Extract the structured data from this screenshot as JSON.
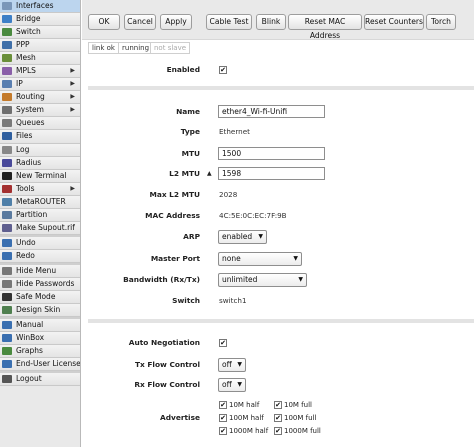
{
  "sidebar": {
    "items": [
      {
        "label": "Interfaces",
        "icon": "interfaces-icon",
        "color": "#7a96b8",
        "submenu": false
      },
      {
        "label": "Bridge",
        "icon": "bridge-icon",
        "color": "#3d7fc6",
        "submenu": false
      },
      {
        "label": "Switch",
        "icon": "switch-icon",
        "color": "#4a8a3f",
        "submenu": false
      },
      {
        "label": "PPP",
        "icon": "ppp-icon",
        "color": "#3f6fa8",
        "submenu": false
      },
      {
        "label": "Mesh",
        "icon": "mesh-icon",
        "color": "#6a8f3a",
        "submenu": false
      },
      {
        "label": "MPLS",
        "icon": "mpls-icon",
        "color": "#8a5fa8",
        "submenu": true
      },
      {
        "label": "IP",
        "icon": "ip-icon",
        "color": "#5a7fb0",
        "submenu": true
      },
      {
        "label": "Routing",
        "icon": "routing-icon",
        "color": "#c47a2a",
        "submenu": true
      },
      {
        "label": "System",
        "icon": "system-icon",
        "color": "#6f6f6f",
        "submenu": true
      },
      {
        "label": "Queues",
        "icon": "queues-icon",
        "color": "#7a7a7a",
        "submenu": false
      },
      {
        "label": "Files",
        "icon": "files-icon",
        "color": "#2f5f9f",
        "submenu": false
      },
      {
        "label": "Log",
        "icon": "log-icon",
        "color": "#888888",
        "submenu": false
      },
      {
        "label": "Radius",
        "icon": "radius-icon",
        "color": "#4a4a9a",
        "submenu": false
      },
      {
        "label": "New Terminal",
        "icon": "terminal-icon",
        "color": "#222222",
        "submenu": false
      },
      {
        "label": "Tools",
        "icon": "tools-icon",
        "color": "#a33030",
        "submenu": true
      },
      {
        "label": "MetaROUTER",
        "icon": "metarouter-icon",
        "color": "#4f7fa8",
        "submenu": false
      },
      {
        "label": "Partition",
        "icon": "partition-icon",
        "color": "#5a7a9f",
        "submenu": false
      },
      {
        "label": "Make Supout.rif",
        "icon": "supout-icon",
        "color": "#5f5f8f",
        "submenu": false
      }
    ],
    "undo_items": [
      {
        "label": "Undo",
        "icon": "undo-icon",
        "color": "#3a6fb0"
      },
      {
        "label": "Redo",
        "icon": "redo-icon",
        "color": "#3a6fb0"
      }
    ],
    "option_items": [
      {
        "label": "Hide Menu",
        "icon": "hide-menu-icon",
        "color": "#777777"
      },
      {
        "label": "Hide Passwords",
        "icon": "hide-passwords-icon",
        "color": "#777777"
      },
      {
        "label": "Safe Mode",
        "icon": "safe-mode-icon",
        "color": "#333333"
      },
      {
        "label": "Design Skin",
        "icon": "design-skin-icon",
        "color": "#4f7f4f"
      }
    ],
    "help_items": [
      {
        "label": "Manual",
        "icon": "manual-icon",
        "color": "#3a6fb0"
      },
      {
        "label": "WinBox",
        "icon": "winbox-icon",
        "color": "#3a6fb0"
      },
      {
        "label": "Graphs",
        "icon": "graphs-icon",
        "color": "#4a8a3f"
      },
      {
        "label": "End-User License",
        "icon": "license-icon",
        "color": "#3a6fb0"
      }
    ],
    "logout": {
      "label": "Logout",
      "icon": "logout-icon",
      "color": "#555555"
    }
  },
  "toolbar": {
    "ok": "OK",
    "cancel": "Cancel",
    "apply": "Apply",
    "cable_test": "Cable Test",
    "blink": "Blink",
    "reset_mac": "Reset MAC Address",
    "reset_counters": "Reset Counters",
    "torch": "Torch"
  },
  "status": {
    "link": "link ok",
    "running": "running",
    "slave": "not slave"
  },
  "form": {
    "enabled": {
      "label": "Enabled",
      "checked": true
    },
    "name": {
      "label": "Name",
      "value": "ether4_Wi-fi-Unifi"
    },
    "type": {
      "label": "Type",
      "value": "Ethernet"
    },
    "mtu": {
      "label": "MTU",
      "value": "1500"
    },
    "l2mtu": {
      "label": "L2 MTU",
      "value": "1598"
    },
    "max_l2mtu": {
      "label": "Max L2 MTU",
      "value": "2028"
    },
    "mac": {
      "label": "MAC Address",
      "value": "4C:5E:0C:EC:7F:9B"
    },
    "arp": {
      "label": "ARP",
      "value": "enabled"
    },
    "master_port": {
      "label": "Master Port",
      "value": "none"
    },
    "bandwidth": {
      "label": "Bandwidth (Rx/Tx)",
      "value": "unlimited"
    },
    "switch": {
      "label": "Switch",
      "value": "switch1"
    },
    "auto_neg": {
      "label": "Auto Negotiation",
      "checked": true
    },
    "tx_flow": {
      "label": "Tx Flow Control",
      "value": "off"
    },
    "rx_flow": {
      "label": "Rx Flow Control",
      "value": "off"
    },
    "advertise": {
      "label": "Advertise",
      "options": [
        {
          "label": "10M half",
          "checked": true
        },
        {
          "label": "10M full",
          "checked": true
        },
        {
          "label": "100M half",
          "checked": true
        },
        {
          "label": "100M full",
          "checked": true
        },
        {
          "label": "1000M half",
          "checked": true
        },
        {
          "label": "1000M full",
          "checked": true
        }
      ]
    }
  }
}
